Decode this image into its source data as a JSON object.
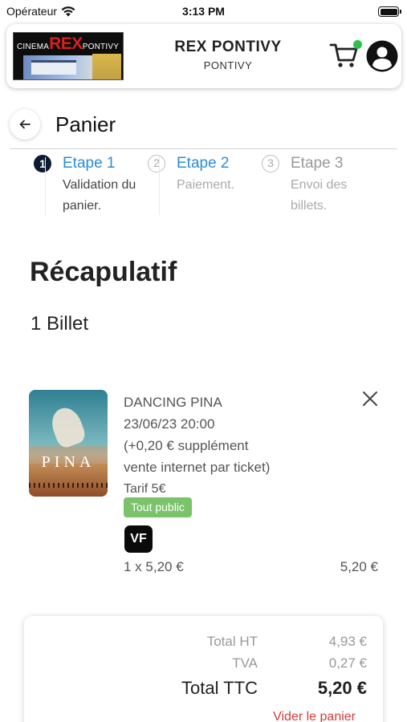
{
  "status_bar": {
    "carrier": "Opérateur",
    "time": "3:13 PM"
  },
  "header": {
    "logo": {
      "small_left": "CINEMA",
      "big": "REX",
      "small_right": "PONTIVY"
    },
    "cinema_name": "REX PONTIVY",
    "city": "PONTIVY",
    "cart_indicator_color": "#2fc14c"
  },
  "page": {
    "title": "Panier"
  },
  "steps": [
    {
      "number": "1",
      "title": "Etape 1",
      "description": "Validation du panier."
    },
    {
      "number": "2",
      "title": "Etape 2",
      "description": "Paiement."
    },
    {
      "number": "3",
      "title": "Etape 3",
      "description": "Envoi des billets."
    }
  ],
  "summary": {
    "title": "Récapulatif",
    "ticket_count": "1 Billet"
  },
  "item": {
    "poster_text": "PINA",
    "movie_title": "DANCING PINA",
    "datetime": "23/06/23 20:00",
    "fee_line_1": "(+0,20 € supplément",
    "fee_line_2": "vente internet par ticket)",
    "tariff": "Tarif 5€",
    "audience_badge": "Tout public",
    "version_badge": "VF",
    "quantity_price": "1 x 5,20 €",
    "line_total": "5,20 €"
  },
  "totals": {
    "ht_label": "Total HT",
    "ht_value": "4,93 €",
    "tva_label": "TVA",
    "tva_value": "0,27 €",
    "ttc_label": "Total TTC",
    "ttc_value": "5,20 €",
    "empty_cart_label": "Vider le panier"
  },
  "colors": {
    "accent_blue": "#2b8cd6",
    "step_active_bg": "#0c1b33",
    "badge_green": "#7ac36b",
    "danger_red": "#d43a3a"
  }
}
